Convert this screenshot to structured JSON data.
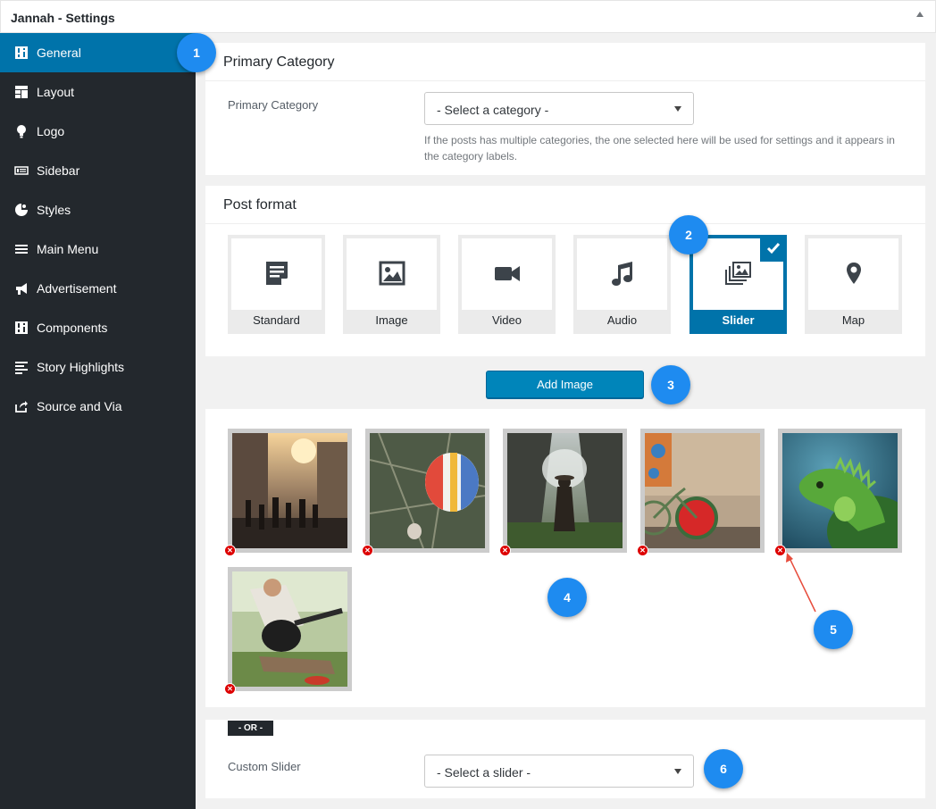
{
  "window": {
    "title": "Jannah - Settings"
  },
  "sidebar": {
    "items": [
      {
        "label": "General",
        "icon": "sliders-icon",
        "active": true
      },
      {
        "label": "Layout",
        "icon": "layout-grid-icon"
      },
      {
        "label": "Logo",
        "icon": "lightbulb-icon"
      },
      {
        "label": "Sidebar",
        "icon": "sidebar-icon"
      },
      {
        "label": "Styles",
        "icon": "palette-icon"
      },
      {
        "label": "Main Menu",
        "icon": "menu-icon"
      },
      {
        "label": "Advertisement",
        "icon": "megaphone-icon"
      },
      {
        "label": "Components",
        "icon": "components-icon"
      },
      {
        "label": "Story Highlights",
        "icon": "text-align-icon"
      },
      {
        "label": "Source and Via",
        "icon": "share-icon"
      }
    ]
  },
  "primary_category": {
    "heading": "Primary Category",
    "label": "Primary Category",
    "select_value": "- Select a category -",
    "help": "If the posts has multiple categories, the one selected here will be used for settings and it appears in the category labels."
  },
  "post_format": {
    "heading": "Post format",
    "options": [
      {
        "label": "Standard",
        "icon": "document-icon"
      },
      {
        "label": "Image",
        "icon": "image-icon"
      },
      {
        "label": "Video",
        "icon": "video-camera-icon"
      },
      {
        "label": "Audio",
        "icon": "music-note-icon"
      },
      {
        "label": "Slider",
        "icon": "gallery-icon",
        "selected": true
      },
      {
        "label": "Map",
        "icon": "map-pin-icon"
      }
    ]
  },
  "gallery": {
    "add_label": "Add Image",
    "images": [
      "city-street-photo",
      "hot-air-balloon-photo",
      "person-in-fog-photo",
      "bicycle-watermelon-photo",
      "iguana-photo",
      "guitar-player-photo"
    ],
    "remove_symbol": "✕"
  },
  "custom_slider": {
    "or_label": "- OR -",
    "label": "Custom Slider",
    "select_value": "- Select a slider -"
  },
  "callouts": [
    "1",
    "2",
    "3",
    "4",
    "5",
    "6"
  ],
  "colors": {
    "accent": "#0073aa",
    "sidebar": "#23282d",
    "badge": "#1e8bf0",
    "remove": "#dd0000"
  }
}
